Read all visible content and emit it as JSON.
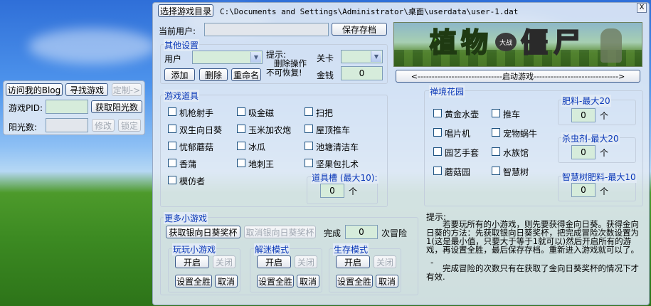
{
  "top_bar": {
    "select_game_dir": "选择游戏目录",
    "path": "C:\\Documents and Settings\\Administrator\\桌面\\userdata\\user-1.dat",
    "close_glyph": "X"
  },
  "left_panel": {
    "visit_blog": "访问我的Blog",
    "find_game": "寻找游戏",
    "customize": "定制->",
    "pid_label": "游戏PID:",
    "pid_value": "",
    "get_sunlight": "获取阳光数",
    "sun_label": "阳光数:",
    "sun_value": "",
    "modify": "修改",
    "lock": "锁定"
  },
  "user": {
    "current_user_label": "当前用户:",
    "current_user_value": "",
    "save_button": "保存存档"
  },
  "other_settings": {
    "title": "其他设置",
    "user_label": "用户",
    "tip_line1": "提示:",
    "tip_line2": "删除操作",
    "tip_line3": "不可恢复!",
    "level_label": "关卡",
    "money_label": "金钱",
    "money_value": "0",
    "add": "添加",
    "delete": "删除",
    "rename": "重命名"
  },
  "banner": {
    "title_chars": [
      "植",
      "物",
      "大战",
      "僵",
      "尸"
    ],
    "launch_button": "<------------------------------启动游戏------------------------------>"
  },
  "game_items": {
    "title": "游戏道具",
    "items": [
      "机枪射手",
      "吸金磁",
      "扫把",
      "双生向日葵",
      "玉米加农炮",
      "屋顶推车",
      "忧郁蘑菇",
      "冰瓜",
      "池塘清洁车",
      "香蒲",
      "地刺王",
      "坚果包扎术",
      "模仿者"
    ],
    "slot_title": "道具槽 (最大10):",
    "slot_value": "0",
    "slot_unit": "个"
  },
  "zen_garden": {
    "title": "禅境花园",
    "items": [
      "黄金水壶",
      "推车",
      "唱片机",
      "宠物蜗牛",
      "园艺手套",
      "水族馆",
      "蘑菇园",
      "智慧树"
    ],
    "fertilizer_title": "肥料-最大20",
    "fertilizer_value": "0",
    "pesticide_title": "杀虫剂-最大20",
    "pesticide_value": "0",
    "tree_food_title": "智慧树肥料-最大10",
    "tree_food_value": "0",
    "unit": "个"
  },
  "mini_games": {
    "title": "更多小游戏",
    "get_award": "获取银向日葵奖杯",
    "cancel_award": "取消银向日葵奖杯",
    "complete_label": "完成",
    "complete_value": "0",
    "adventure_label": "次冒险",
    "groups": [
      {
        "title": "玩玩小游戏",
        "open": "开启",
        "close": "关闭",
        "win_all": "设置全胜",
        "cancel": "取消"
      },
      {
        "title": "解迷模式",
        "open": "开启",
        "close": "关闭",
        "win_all": "设置全胜",
        "cancel": "取消"
      },
      {
        "title": "生存模式",
        "open": "开启",
        "close": "关闭",
        "win_all": "设置全胜",
        "cancel": "取消"
      }
    ]
  },
  "hint": {
    "title": "提示:",
    "body": "　　若要玩所有的小游戏，则先要获得金向日葵。获得金向日葵的方法：先获取银向日葵奖杯，把完成冒险次数设置为1(这是最小值，只要大于等于1就可以)然后开启所有的游戏，再设置全胜，最后保存存档。重新进入游戏就可以了。",
    "dash": "-",
    "note": "　　完成冒险的次数只有在获取了金向日葵奖杯的情况下才有效."
  },
  "colors": {
    "group_title": "#0a38b8",
    "field_green": "#d6ecdb",
    "panel_bg": "#e1eaf5"
  }
}
